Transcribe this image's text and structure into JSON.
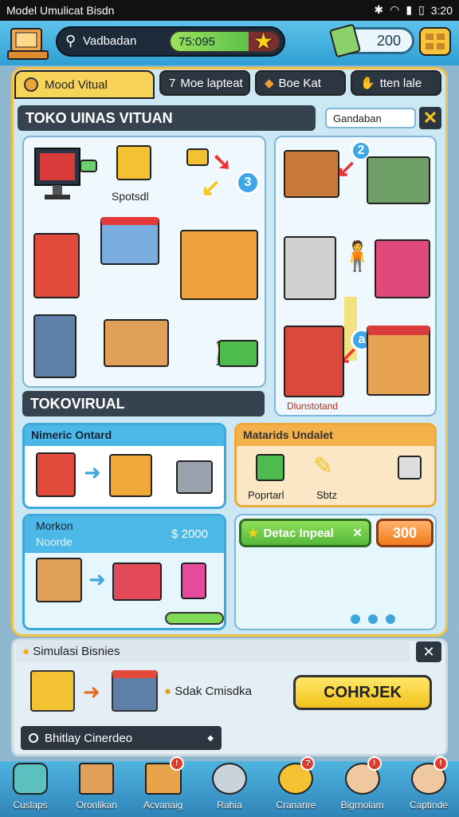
{
  "status": {
    "left_text": "Model Umulicat Bisdn",
    "time": "3:20",
    "battery": "99"
  },
  "header": {
    "search_value": "Vadbadan",
    "progress_text": "75:095",
    "progress_pct": 0.72,
    "coins": "200"
  },
  "tabs": [
    {
      "label": "Mood Vitual"
    },
    {
      "label": "Moe lapteat",
      "prefix": "7"
    },
    {
      "label": "Boe Kat"
    },
    {
      "label": "tten lale"
    }
  ],
  "store": {
    "title": "TOKO UINAS VITUAN",
    "filter_value": "Gandaban"
  },
  "left_grid": {
    "label": "Spotsdl",
    "badge": "3"
  },
  "right_grid": {
    "badge_top": "2",
    "badge_mid": "a",
    "caption": "Dlunstotand"
  },
  "section2": {
    "title": "TOKOVIRUAL"
  },
  "card_a": {
    "title": "Nimeric Ontard"
  },
  "card_b": {
    "title": "Matarids Undalet",
    "items": [
      "Poprtarl",
      "Sbtz"
    ]
  },
  "card_c": {
    "title": "Morkon",
    "subtitle": "Noorde",
    "price": "$ 2000"
  },
  "card_d": {
    "button": "Detac Inpeal",
    "value": "300"
  },
  "sim": {
    "title": "Simulasi Bisnies",
    "label": "Sdak Cmisdka",
    "button": "COHRJEK",
    "select": "Bhitlay Cinerdeo"
  },
  "nav": [
    {
      "label": "Cuslaps"
    },
    {
      "label": "Oronlikan"
    },
    {
      "label": "Acvanaig"
    },
    {
      "label": "Rahia"
    },
    {
      "label": "Cranarire"
    },
    {
      "label": "Bigrnolam"
    },
    {
      "label": "Captinde"
    }
  ]
}
